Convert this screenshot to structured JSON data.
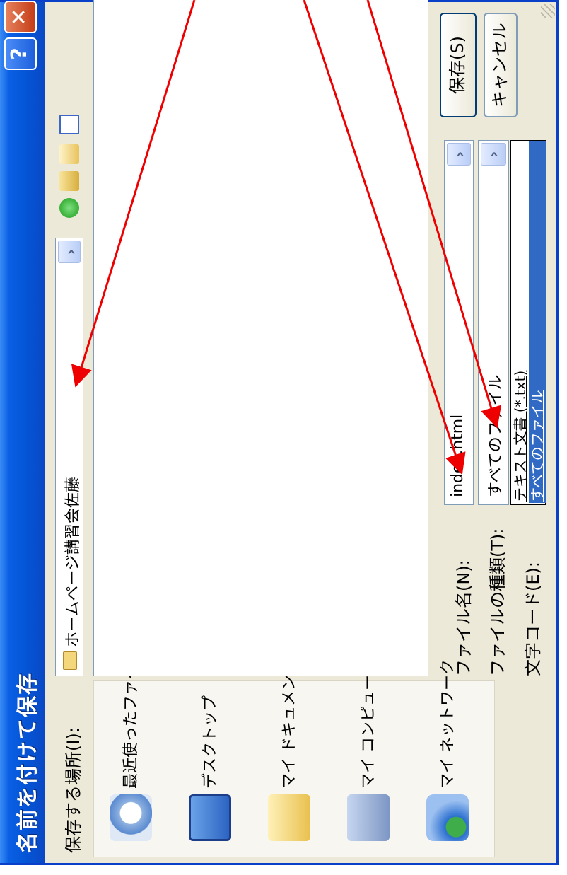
{
  "dialog": {
    "title": "名前を付けて保存",
    "help_button": "?",
    "close_button": "✕"
  },
  "save_in": {
    "label": "保存する場所(I):",
    "value": "ホームページ講習会佐藤"
  },
  "places": [
    {
      "label": "最近使ったファイル",
      "icon": "recent-files-icon"
    },
    {
      "label": "デスクトップ",
      "icon": "desktop-icon"
    },
    {
      "label": "マイ ドキュメント",
      "icon": "my-documents-icon"
    },
    {
      "label": "マイ コンピュータ",
      "icon": "my-computer-icon"
    },
    {
      "label": "マイ ネットワーク",
      "icon": "my-network-icon"
    }
  ],
  "toolbar": {
    "icons": [
      "back-icon",
      "up-folder-icon",
      "new-folder-icon",
      "views-menu-icon"
    ]
  },
  "file_name": {
    "label": "ファイル名(N):",
    "value": "index.html"
  },
  "file_type": {
    "label": "ファイルの種類(T):",
    "value": "すべてのファイル",
    "options": [
      "テキスト文書 (*.txt)",
      "すべてのファイル"
    ]
  },
  "encoding": {
    "label": "文字コード(E):"
  },
  "buttons": {
    "save": "保存(S)",
    "cancel": "キャンセル"
  },
  "colors": {
    "titlebar": "#0a5fe3",
    "annotation_arrow": "#ee0000",
    "selection": "#316ac5"
  }
}
